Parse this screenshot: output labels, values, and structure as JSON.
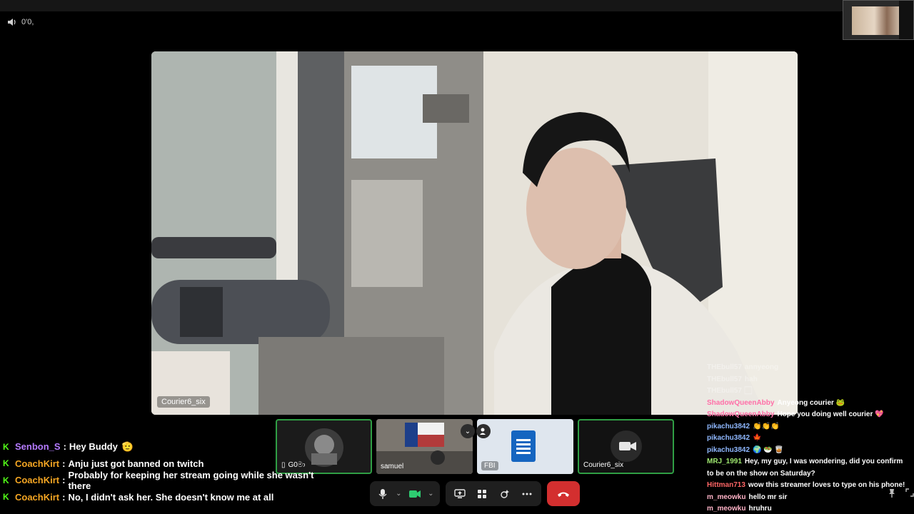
{
  "volume": {
    "icon": "speaker-icon",
    "label": "0'0,"
  },
  "main_video": {
    "name": "Courier6_six"
  },
  "participants": [
    {
      "name": "G0මා",
      "icon": "phone-icon",
      "speaking": true
    },
    {
      "name": "samuel",
      "speaking": false
    },
    {
      "name": "FBI",
      "icon": "document-icon",
      "speaking": false
    },
    {
      "name": "Courier6_six",
      "icon": "camera-off-icon",
      "speaking": true
    }
  ],
  "controls": {
    "mic": "microphone-icon",
    "camera": "camera-icon",
    "share": "screen-share-icon",
    "apps": "apps-icon",
    "effects": "effects-icon",
    "more": "more-icon",
    "end": "end-call-icon"
  },
  "chat_left": [
    {
      "user": "Senbon_S",
      "color": "#b57bff",
      "message": "Hey Buddy",
      "emoji": "🫡"
    },
    {
      "user": "CoachKirt",
      "color": "#f5a623",
      "message": "Anju just got banned on twitch"
    },
    {
      "user": "CoachKirt",
      "color": "#f5a623",
      "message": "Probably for keeping her stream going while she wasn't there"
    },
    {
      "user": "CoachKirt",
      "color": "#f5a623",
      "message": "No, I didn't ask her. She doesn't know me at all"
    }
  ],
  "chat_right": [
    {
      "user": "THEbull57",
      "color": "#ffffff",
      "message": "annyeong",
      "faded": true
    },
    {
      "user": "THEbull57",
      "color": "#ffffff",
      "message": "hah",
      "faded": true
    },
    {
      "user": "THEbull57",
      "color": "#ffffff",
      "message": "🏻",
      "faded": true
    },
    {
      "user": "ShadowQueenAbby",
      "color": "#ff6fa8",
      "message": "Anyeong courier 🐸"
    },
    {
      "user": "ShadowQueenAbby",
      "color": "#ff6fa8",
      "message": "Hope you doing well courier 💖"
    },
    {
      "user": "pikachu3842",
      "color": "#8fb8ff",
      "message": "👏👏👏"
    },
    {
      "user": "pikachu3842",
      "color": "#8fb8ff",
      "message": "🍁"
    },
    {
      "user": "pikachu3842",
      "color": "#8fb8ff",
      "message": "🌍 🥗 🥃"
    },
    {
      "user": "MRJ_1991",
      "color": "#9fe870",
      "message": "Hey, my guy, I was wondering, did you confirm to be on the show on Saturday?"
    },
    {
      "user": "Hittman713",
      "color": "#ff6666",
      "message": "wow this streamer loves to type on his phone!"
    },
    {
      "user": "m_meowku",
      "color": "#ffb3c7",
      "message": "hello mr sir"
    },
    {
      "user": "m_meowku",
      "color": "#ffb3c7",
      "message": "hruhru"
    }
  ]
}
